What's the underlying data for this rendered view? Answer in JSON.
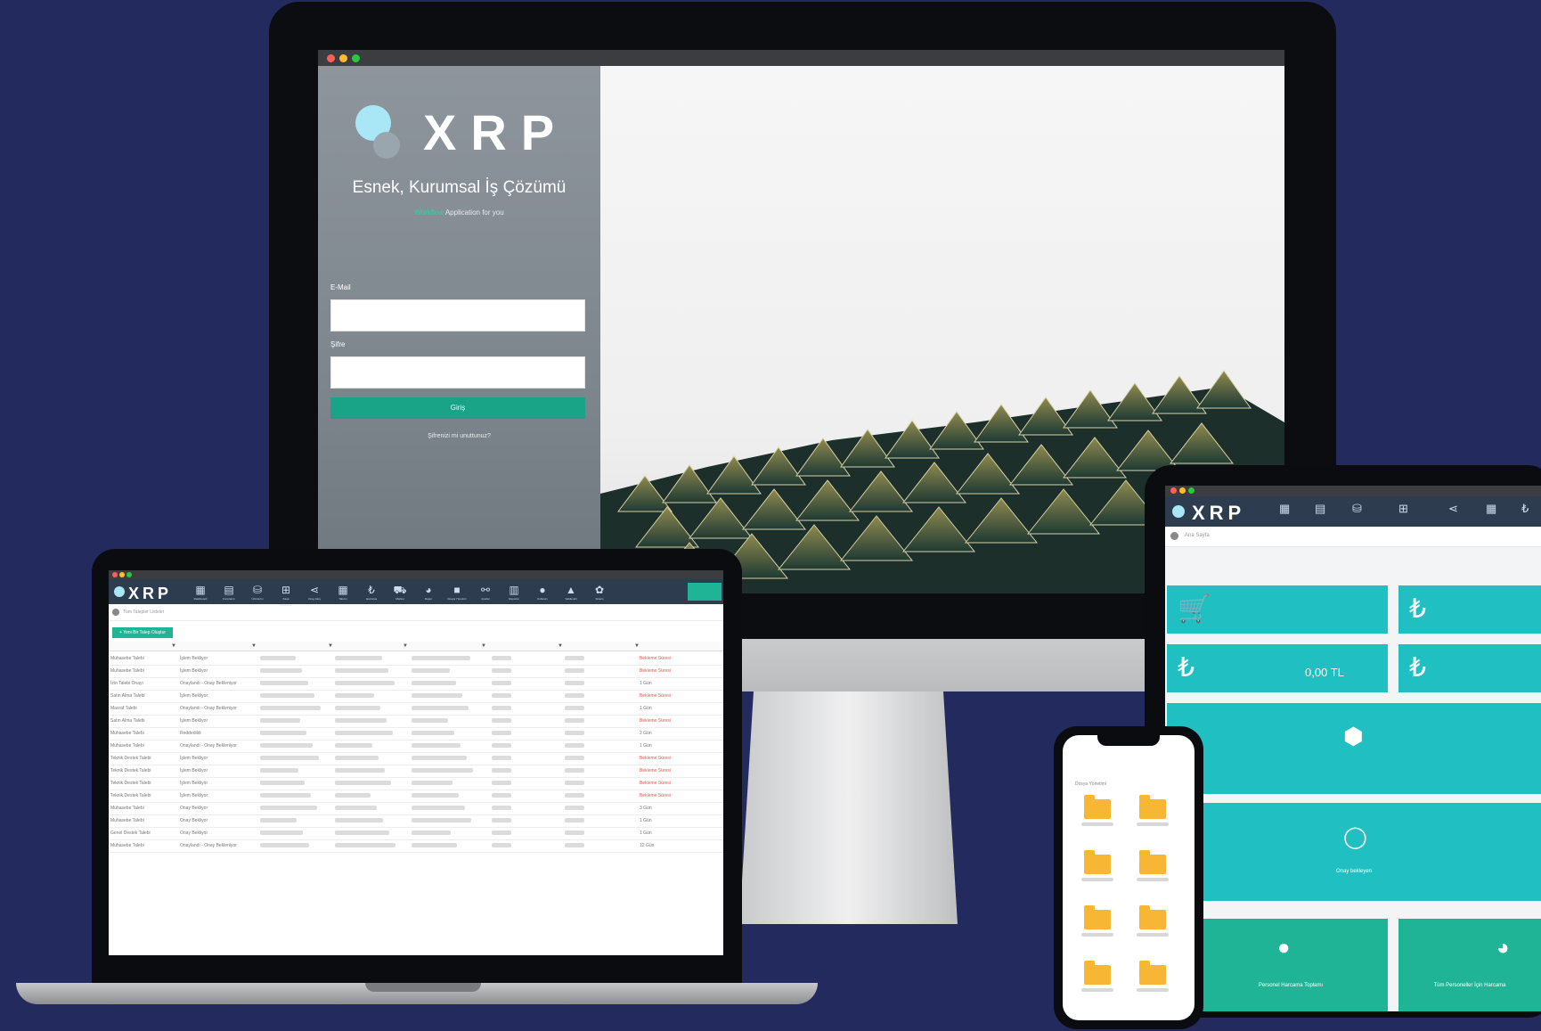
{
  "brand": {
    "name": "XRP",
    "accent_teal": "#1fb496",
    "tile_cyan": "#20c0c2",
    "background": "#232a5e"
  },
  "imac": {
    "tagline": "Esnek, Kurumsal İş Çözümü",
    "subtagline_link": "Workflow",
    "subtagline_rest": "Application for you",
    "email_label": "E-Mail",
    "password_label": "Şifre",
    "login_button": "Giriş",
    "forgot_link": "Şifrenizi mi unuttunuz?"
  },
  "laptop": {
    "nav_items": [
      {
        "icon": "dashboard-icon",
        "glyph": "▦",
        "label": "Dashboard"
      },
      {
        "icon": "document-icon",
        "glyph": "▤",
        "label": "Formlarım"
      },
      {
        "icon": "basket-icon",
        "glyph": "⛁",
        "label": "Ürünlerim"
      },
      {
        "icon": "grid-icon",
        "glyph": "⊞",
        "label": "Kasa Hareketleri"
      },
      {
        "icon": "share-icon",
        "glyph": "⋖",
        "label": "Onay Akış"
      },
      {
        "icon": "calendar-icon",
        "glyph": "▦",
        "label": "Takvim"
      },
      {
        "icon": "lira-icon",
        "glyph": "₺",
        "label": "Harcama"
      },
      {
        "icon": "cart-icon",
        "glyph": "⛟",
        "label": "Market"
      },
      {
        "icon": "chart-icon",
        "glyph": "◕",
        "label": "Rapor"
      },
      {
        "icon": "folder-icon",
        "glyph": "■",
        "label": "Dosya Yönetimi"
      },
      {
        "icon": "flow-icon",
        "glyph": "⚯",
        "label": "Ayarlar"
      },
      {
        "icon": "bars-icon",
        "glyph": "▥",
        "label": "Raporlar"
      },
      {
        "icon": "user-icon",
        "glyph": "●",
        "label": "Kullanıcı"
      },
      {
        "icon": "lock-icon",
        "glyph": "▲",
        "label": "Yetkilendir"
      },
      {
        "icon": "gear-icon",
        "glyph": "✿",
        "label": "Sistem"
      }
    ],
    "breadcrumb": "Tüm Talepler Listeler",
    "add_button": "+ Yeni Bir Talep Oluştur",
    "rows": [
      {
        "c1": "Muhasebe Talebi",
        "c2": "İşlem Bekliyor",
        "c7": "Bekleme Süresi",
        "red": true
      },
      {
        "c1": "Muhasebe Talebi",
        "c2": "İşlem Bekliyor",
        "c7": "Bekleme Süresi",
        "red": true
      },
      {
        "c1": "İzin Talebi Onayı",
        "c2": "Onaylandı - Onay Bekleniyor",
        "c7": "1 Gün",
        "red": false
      },
      {
        "c1": "Satın Alma Talebi",
        "c2": "İşlem Bekliyor",
        "c7": "Bekleme Süresi",
        "red": true
      },
      {
        "c1": "Masraf Talebi",
        "c2": "Onaylandı - Onay Bekleniyor",
        "c7": "1 Gün",
        "red": false
      },
      {
        "c1": "Satın Alma Talebi",
        "c2": "İşlem Bekliyor",
        "c7": "Bekleme Süresi",
        "red": true
      },
      {
        "c1": "Muhasebe Talebi",
        "c2": "Reddedildi",
        "c7": "2 Gün",
        "red": false
      },
      {
        "c1": "Muhasebe Talebi",
        "c2": "Onaylandı - Onay Bekleniyor",
        "c7": "1 Gün",
        "red": false
      },
      {
        "c1": "Teknik Destek Talebi",
        "c2": "İşlem Bekliyor",
        "c7": "Bekleme Süresi",
        "red": true
      },
      {
        "c1": "Teknik Destek Talebi",
        "c2": "İşlem Bekliyor",
        "c7": "Bekleme Süresi",
        "red": true
      },
      {
        "c1": "Teknik Destek Talebi",
        "c2": "İşlem Bekliyor",
        "c7": "Bekleme Süresi",
        "red": true
      },
      {
        "c1": "Teknik Destek Talebi",
        "c2": "İşlem Bekliyor",
        "c7": "Bekleme Süresi",
        "red": true
      },
      {
        "c1": "Muhasebe Talebi",
        "c2": "Onay Bekliyor",
        "c7": "3 Gün",
        "red": false
      },
      {
        "c1": "Muhasebe Talebi",
        "c2": "Onay Bekliyor",
        "c7": "1 Gün",
        "red": false
      },
      {
        "c1": "Genel Destek Talebi",
        "c2": "Onay Bekliyor",
        "c7": "1 Gün",
        "red": false
      },
      {
        "c1": "Muhasebe Talebi",
        "c2": "Onaylandı - Onay Bekleniyor",
        "c7": "12 Gün",
        "red": false
      }
    ]
  },
  "tablet": {
    "breadcrumb": "Ana Sayfa",
    "tile_amount": "0,00 TL",
    "tile_chat_title": "Onay bekleyen",
    "tile_person_title": "Personel Harcama Toplamı",
    "tile_all_title": "Tüm Personeller İçin Harcama"
  },
  "phone": {
    "header": "Dosya Yönetimi"
  }
}
